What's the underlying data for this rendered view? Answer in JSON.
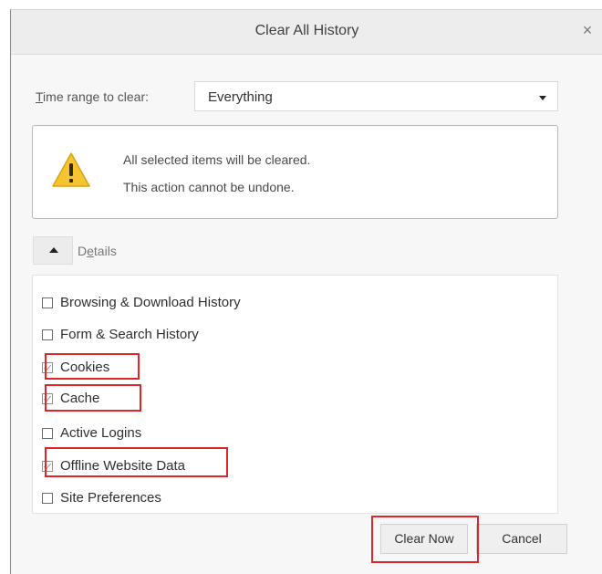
{
  "dialog": {
    "title": "Clear All History",
    "close_glyph": "×",
    "close_icon": "close-icon"
  },
  "time_range": {
    "label_accel": "T",
    "label_rest": "ime range to clear:",
    "selected": "Everything"
  },
  "warning": {
    "icon": "warning-triangle-icon",
    "line1": "All selected items will be cleared.",
    "line2": "This action cannot be undone."
  },
  "details": {
    "toggle_icon": "chevron-up-icon",
    "label_start": "D",
    "label_accel": "e",
    "label_rest": "tails"
  },
  "items": [
    {
      "label": "Browsing & Download History",
      "checked": false,
      "highlighted": false
    },
    {
      "label": "Form & Search History",
      "checked": false,
      "highlighted": false
    },
    {
      "label": "Cookies",
      "checked": true,
      "highlighted": true
    },
    {
      "label": "Cache",
      "checked": true,
      "highlighted": true
    },
    {
      "label": "Active Logins",
      "checked": false,
      "highlighted": false
    },
    {
      "label": "Offline Website Data",
      "checked": true,
      "highlighted": true
    },
    {
      "label": "Site Preferences",
      "checked": false,
      "highlighted": false
    }
  ],
  "buttons": {
    "clear_now": "Clear Now",
    "cancel": "Cancel"
  },
  "colors": {
    "highlight": "#e1242a",
    "warning_yellow": "#f5c430"
  }
}
